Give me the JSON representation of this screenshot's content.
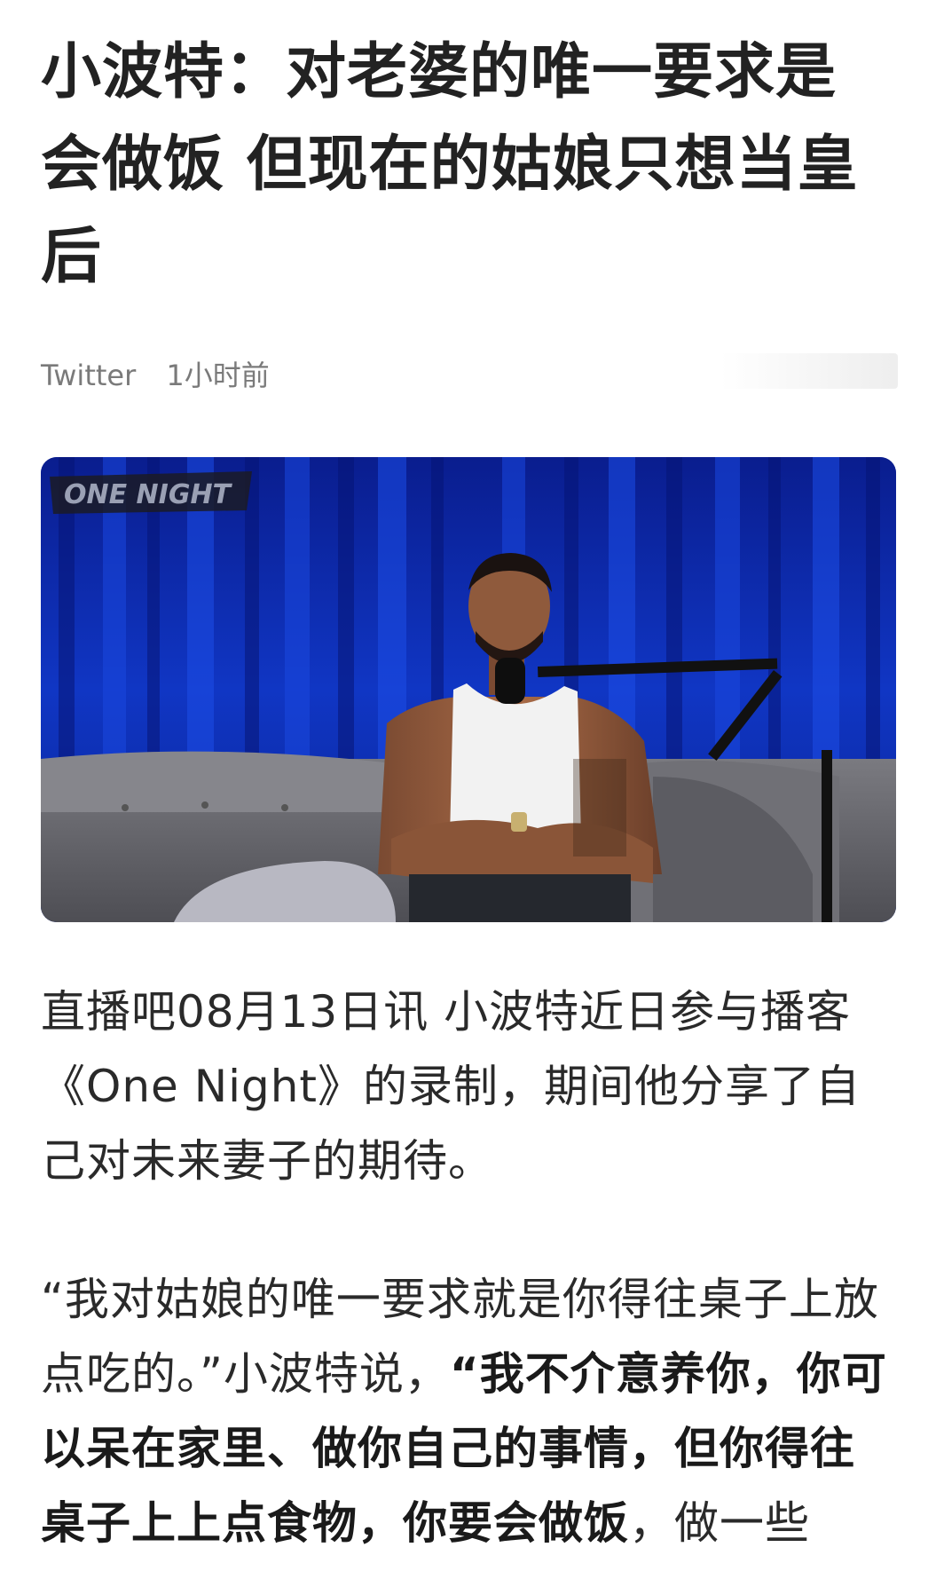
{
  "article": {
    "title": "小波特：对老婆的唯一要求是会做饭 但现在的姑娘只想当皇后",
    "source": "Twitter",
    "time": "1小时前",
    "image": {
      "logo_text": "ONE NIGHT"
    },
    "paragraph1": "直播吧08月13日讯 小波特近日参与播客《One Night》的录制，期间他分享了自己对未来妻子的期待。",
    "paragraph2_plain": "“我对姑娘的唯一要求就是你得往桌子上放点吃的。”小波特说，",
    "paragraph2_bold": "“我不介意养你，你可以呆在家里、做你自己的事情，但你得往桌子上上点食物，你要会做饭",
    "paragraph2_tail": "，做一些"
  },
  "colors": {
    "title": "#222222",
    "meta": "#7a7a7a",
    "body": "#2a2a2a",
    "curtain": "#0b2aa8",
    "sofa": "#6e6e72"
  }
}
